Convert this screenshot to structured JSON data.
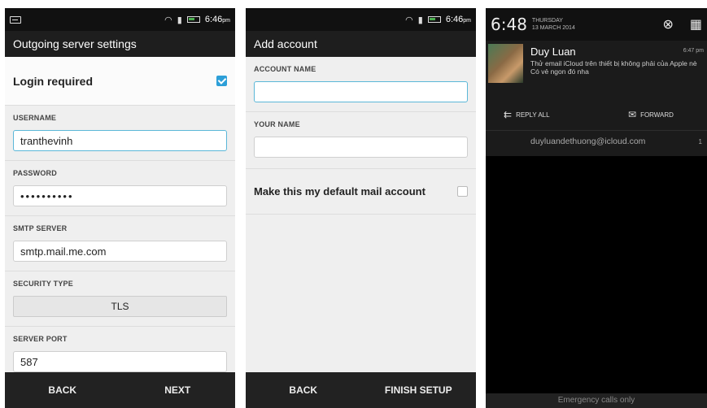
{
  "screen1": {
    "status_time": "6:46",
    "status_ampm": "pm",
    "title": "Outgoing server settings",
    "login_required_label": "Login required",
    "username_label": "USERNAME",
    "username_value": "tranthevinh",
    "password_label": "PASSWORD",
    "password_value": "••••••••••",
    "smtp_label": "SMTP SERVER",
    "smtp_value": "smtp.mail.me.com",
    "security_label": "SECURITY TYPE",
    "security_value": "TLS",
    "port_label": "SERVER PORT",
    "port_value": "587",
    "back_label": "BACK",
    "next_label": "NEXT"
  },
  "screen2": {
    "status_time": "6:46",
    "status_ampm": "pm",
    "title": "Add account",
    "account_name_label": "ACCOUNT NAME",
    "your_name_label": "YOUR NAME",
    "default_label": "Make this my default mail account",
    "back_label": "BACK",
    "finish_label": "FINISH SETUP"
  },
  "screen3": {
    "clock": "6:48",
    "day": "THURSDAY",
    "date": "13 MARCH 2014",
    "sender": "Duy Luan",
    "time": "6:47 pm",
    "message": "Thử email iCloud trên thiết bị không phải của Apple nè Có vẻ ngon đó nha",
    "reply_all": "REPLY ALL",
    "forward": "FORWARD",
    "address": "duyluandethuong@icloud.com",
    "count": "1",
    "emergency": "Emergency calls only"
  }
}
